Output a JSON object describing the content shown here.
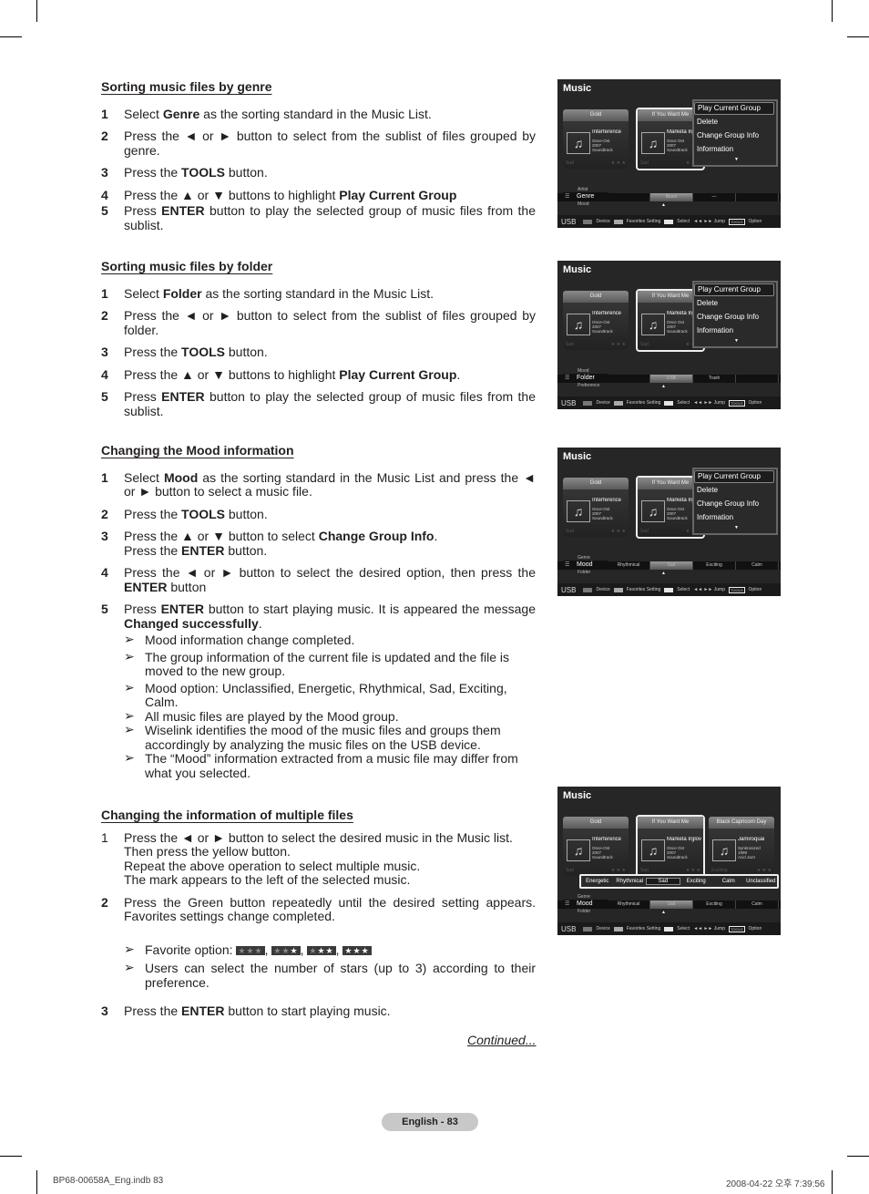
{
  "sections": [
    {
      "title": "Sorting music files by genre",
      "steps": [
        {
          "num": "1",
          "html": "Select <b>Genre</b> as the sorting standard in the Music List."
        },
        {
          "num": "2",
          "html": "Press the ◄ or ► button to select from the sublist of files grouped by genre."
        },
        {
          "num": "3",
          "html": "Press the <b>TOOLS</b> button."
        },
        {
          "num": "4",
          "html": "Press the ▲ or ▼ buttons  to highlight <b>Play Current Group</b>"
        },
        {
          "num": "5",
          "html": "Press <b>ENTER</b> button to play the selected group of music files from the sublist."
        }
      ]
    },
    {
      "title": "Sorting music files by folder",
      "steps": [
        {
          "num": "1",
          "html": "Select <b>Folder</b> as the sorting standard in the Music List."
        },
        {
          "num": "2",
          "html": "Press the ◄ or ► button to select from the sublist of files grouped by folder."
        },
        {
          "num": "3",
          "html": "Press the <b>TOOLS</b> button."
        },
        {
          "num": "4",
          "html": "Press the ▲ or ▼ buttons  to highlight <b>Play Current Group</b>."
        },
        {
          "num": "5",
          "html": "Press <b>ENTER</b> button to play the selected group of music files from the sublist."
        }
      ]
    },
    {
      "title": "Changing the Mood information",
      "steps": [
        {
          "num": "1",
          "html": "Select <b>Mood</b> as the sorting standard in the Music List and press the ◄ or ► button to select a music file."
        },
        {
          "num": "2",
          "html": "Press the <b>TOOLS</b> button."
        },
        {
          "num": "3",
          "html": "Press the ▲ or ▼ button to select <b>Change Group Info</b>.<br>Press the <b>ENTER</b> button."
        },
        {
          "num": "4",
          "html": "Press the ◄ or ► button to select the desired option, then press the <b>ENTER</b> button"
        },
        {
          "num": "5",
          "html": "Press <b>ENTER</b> button to start playing music. It is appeared the message <b>Changed successfully</b>."
        }
      ],
      "notes": [
        "Mood information change completed.",
        "The group information of the current file is updated and the file is moved to the new group.",
        "Mood option: Unclassified, Energetic, Rhythmical, Sad, Exciting, Calm.",
        "All music files are played by the Mood group.",
        "Wiselink identifies the mood of the music files and groups them accordingly by analyzing the music files on the USB device.",
        "The “Mood” information extracted from a music file may differ from what you selected."
      ]
    },
    {
      "title": "Changing the information of multiple files",
      "steps": [
        {
          "num": "1",
          "html": "Press the ◄ or ► button to select the desired music in the Music list.<br>Then press the yellow button.<br>Repeat the above operation to select multiple music.<br>The mark appears to the left of the selected music."
        },
        {
          "num": "2",
          "html": "Press the Green button repeatedly until the desired setting appears. Favorites settings change completed."
        }
      ],
      "notes": [
        "Favorite option:",
        "Users can select the number of stars (up to 3) according to their preference."
      ],
      "favorite_option_stars": [
        0,
        1,
        2,
        3
      ],
      "step3": {
        "num": "3",
        "html": "Press the <b>ENTER</b> button to start playing music."
      }
    }
  ],
  "continued": "Continued...",
  "page_label": "English - 83",
  "slug_left": "BP68-00658A_Eng.indb   83",
  "slug_right": "2008-04-22   오후 7:39:56",
  "tv": {
    "title": "Music",
    "cards": [
      {
        "head": "Gold",
        "artist": "Interference",
        "meta": [
          "Once-Ost",
          "2007",
          "Soundtrack"
        ],
        "mood": "Sad"
      },
      {
        "head": "If You Want Me",
        "artist": "Marketa Irglova",
        "meta": [
          "Once Ost",
          "2007",
          "Soundtrack"
        ],
        "mood": "Sad"
      },
      {
        "head": "Black Capricorn Day",
        "artist": "Jamiroquai",
        "meta": [
          "Synkronized",
          "1999",
          "Acid Jazz"
        ],
        "mood": "Exciting"
      }
    ],
    "menu": [
      "Play Current Group",
      "Delete",
      "Change Group Info",
      "Information"
    ],
    "footer": {
      "usb": "USB",
      "device": "Device",
      "favorites": "Favorites Setting",
      "select": "Select",
      "jump": "◄◄ ►► Jump",
      "tools": "TOOLS",
      "option": "Option"
    },
    "screens": [
      {
        "sort_above": "Artist",
        "sort": "Genre",
        "sort_below": "Mood",
        "cells": [
          "",
          "Blues",
          "—",
          ""
        ],
        "current": 1
      },
      {
        "sort_above": "Mood",
        "sort": "Folder",
        "sort_below": "Preference",
        "cells": [
          "",
          "USB",
          "Trash",
          ""
        ],
        "current": 1
      },
      {
        "sort_above": "Genre",
        "sort": "Mood",
        "sort_below": "Folder",
        "cells": [
          "Rhythmical",
          "Sad",
          "Exciting",
          "Calm"
        ],
        "current": 1
      },
      {
        "sort_above": "Genre",
        "sort": "Mood",
        "sort_below": "Folder",
        "cells": [
          "Rhythmical",
          "Sad",
          "Exciting",
          "Calm"
        ],
        "current": 1
      }
    ],
    "mood_options": [
      "Energetic",
      "Rhythmical",
      "Sad",
      "Exciting",
      "Calm",
      "Unclassified"
    ],
    "mood_selected": "Sad"
  }
}
